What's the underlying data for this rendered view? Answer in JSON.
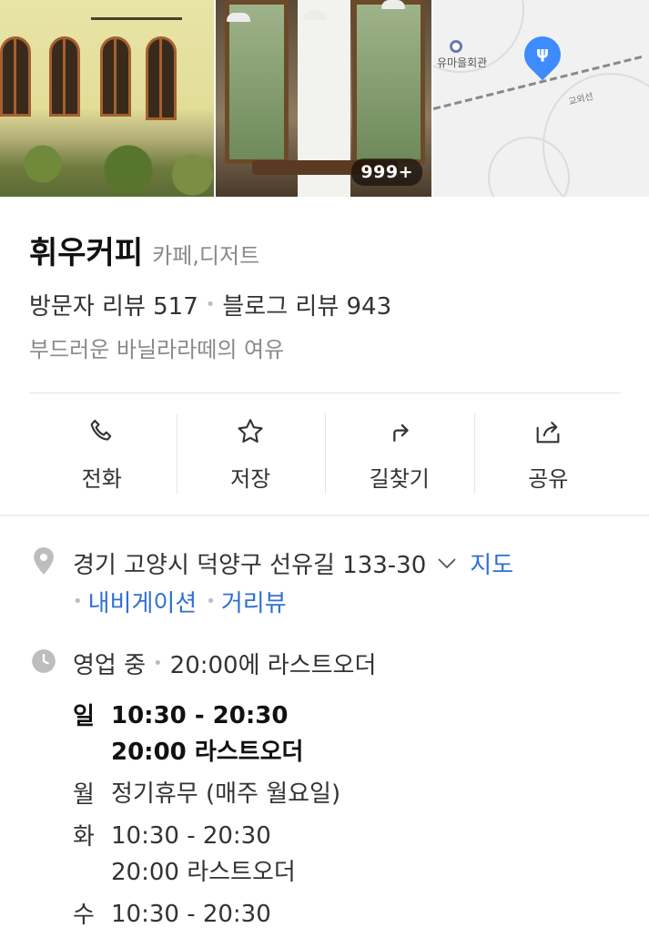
{
  "photos": {
    "more_count": "999+"
  },
  "map": {
    "landmark_label": "유마을회관",
    "rail_label": "교외선"
  },
  "place": {
    "name": "휘우커피",
    "category": "카페,디저트",
    "visitor_reviews": "방문자 리뷰 517",
    "blog_reviews": "블로그 리뷰 943",
    "tagline": "부드러운 바닐라라떼의 여유"
  },
  "actions": [
    {
      "label": "전화",
      "icon": "phone-icon"
    },
    {
      "label": "저장",
      "icon": "star-icon"
    },
    {
      "label": "길찾기",
      "icon": "directions-icon"
    },
    {
      "label": "공유",
      "icon": "share-icon"
    }
  ],
  "address": {
    "text": "경기 고양시 덕양구 선유길 133-30",
    "map_link": "지도",
    "navigation_link": "내비게이션",
    "streetview_link": "거리뷰"
  },
  "business": {
    "status": "영업 중",
    "last_order_note": "20:00에 라스트오더",
    "hours": [
      {
        "day": "일",
        "time": "10:30 - 20:30",
        "note": "20:00 라스트오더",
        "bold": true
      },
      {
        "day": "월",
        "time": "정기휴무 (매주 월요일)",
        "note": "",
        "bold": false
      },
      {
        "day": "화",
        "time": "10:30 - 20:30",
        "note": "20:00 라스트오더",
        "bold": false
      },
      {
        "day": "수",
        "time": "10:30 - 20:30",
        "note": "",
        "bold": false
      }
    ]
  },
  "colors": {
    "link": "#2f6fd6",
    "map_pin": "#3d8bfd"
  }
}
